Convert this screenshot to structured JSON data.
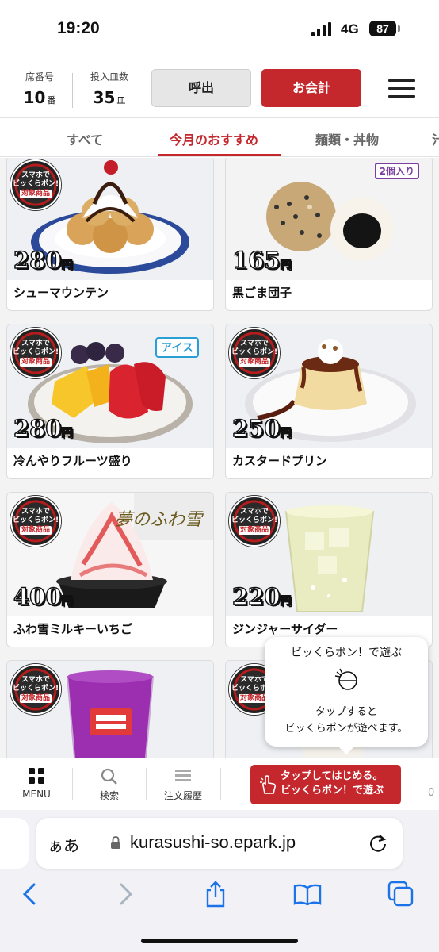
{
  "status_bar": {
    "time": "19:20",
    "network": "4G",
    "battery": "87"
  },
  "header": {
    "seat_label": "席番号",
    "seat_value": "10",
    "seat_unit": "番",
    "plates_label": "投入皿数",
    "plates_value": "35",
    "plates_unit": "皿",
    "call_button": "呼出",
    "pay_button": "お会計"
  },
  "tabs": [
    {
      "label": "すべて",
      "active": false
    },
    {
      "label": "今月のおすすめ",
      "active": true
    },
    {
      "label": "麺類・丼物",
      "active": false
    },
    {
      "label": "汁",
      "active": false
    }
  ],
  "badges": {
    "smartphone_line1": "スマホで",
    "smartphone_line2": "ビッくらポン!",
    "smartphone_line3": "対象商品",
    "ice": "アイス",
    "count": "2個入り",
    "fuwa_logo": "夢のふわ雪",
    "yen": "円"
  },
  "products": [
    {
      "name": "シューマウンテン",
      "price": "280"
    },
    {
      "name": "黒ごま団子",
      "price": "165"
    },
    {
      "name": "冷んやりフルーツ盛り",
      "price": "280"
    },
    {
      "name": "カスタードプリン",
      "price": "250"
    },
    {
      "name": "ふわ雪ミルキーいちご",
      "price": "400"
    },
    {
      "name": "ジンジャーサイダー",
      "price": "220"
    }
  ],
  "tooltip": {
    "title": "ビッくらポン！で遊ぶ",
    "line1": "タップすると",
    "line2": "ビッくらポンが遊べます。"
  },
  "bottom_nav": {
    "menu": "MENU",
    "search": "検索",
    "history": "注文履歴",
    "play_line1": "タップしてはじめる。",
    "play_line2": "ビッくらポン！で遊ぶ",
    "edge": "0"
  },
  "safari": {
    "aa": "ぁあ",
    "url": "kurasushi-so.epark.jp"
  },
  "colors": {
    "brand_red": "#c4272c",
    "ice_blue": "#2a9fd6",
    "count_purple": "#7b3fa0"
  }
}
